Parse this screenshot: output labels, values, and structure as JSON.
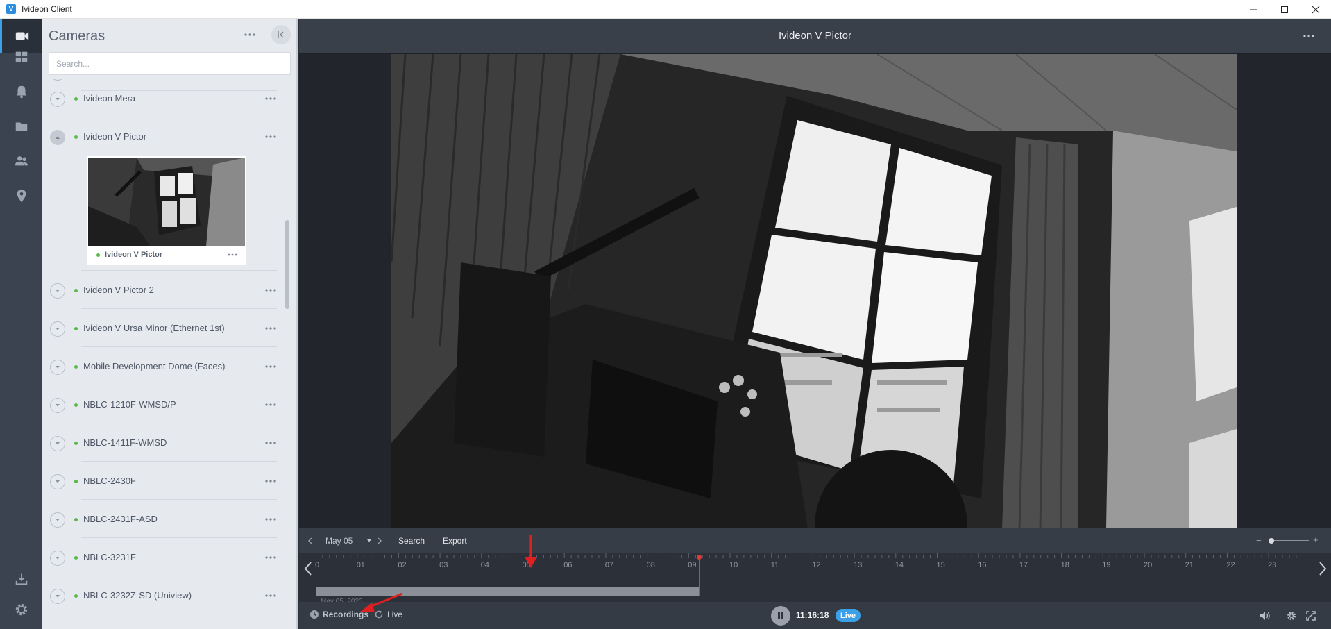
{
  "app": {
    "title": "Ivideon Client",
    "logo": "V"
  },
  "window_controls": [
    "minimize-icon",
    "maximize-icon",
    "close-icon"
  ],
  "rail": {
    "items": [
      "camera-icon",
      "grid-icon",
      "bell-icon",
      "folder-icon",
      "users-icon",
      "location-pin-icon"
    ],
    "bottom": [
      "download-icon",
      "gear-icon"
    ]
  },
  "panel": {
    "title": "Cameras",
    "search_placeholder": "Search...",
    "cameras": [
      {
        "name": "Ivideon Mera",
        "online": true,
        "expanded": false
      },
      {
        "name": "Ivideon V Pictor",
        "online": true,
        "expanded": true
      },
      {
        "name": "Ivideon V Pictor 2",
        "online": true,
        "expanded": false
      },
      {
        "name": "Ivideon V Ursa Minor (Ethernet 1st)",
        "online": true,
        "expanded": false
      },
      {
        "name": "Mobile Development Dome (Faces)",
        "online": true,
        "expanded": false
      },
      {
        "name": "NBLC-1210F-WMSD/P",
        "online": true,
        "expanded": false
      },
      {
        "name": "NBLC-1411F-WMSD",
        "online": true,
        "expanded": false
      },
      {
        "name": "NBLC-2430F",
        "online": true,
        "expanded": false
      },
      {
        "name": "NBLC-2431F-ASD",
        "online": true,
        "expanded": false
      },
      {
        "name": "NBLC-3231F",
        "online": true,
        "expanded": false
      },
      {
        "name": "NBLC-3232Z-SD (Uniview)",
        "online": true,
        "expanded": false
      }
    ],
    "preview_label": "Ivideon V Pictor"
  },
  "main": {
    "camera_title": "Ivideon V Pictor"
  },
  "timeline": {
    "date": "May 05",
    "search_label": "Search",
    "export_label": "Export",
    "hours": [
      "0",
      "01",
      "02",
      "03",
      "04",
      "05",
      "06",
      "07",
      "08",
      "09",
      "10",
      "11",
      "12",
      "13",
      "14",
      "15",
      "16",
      "17",
      "18",
      "19",
      "20",
      "21",
      "22",
      "23"
    ],
    "recording_date": "May 05, 2023",
    "recordings_label": "Recordings",
    "live_label": "Live",
    "current_time": "11:16:18",
    "live_badge": "Live"
  },
  "colors": {
    "accent": "#3aa0e8",
    "online": "#58b848",
    "playhead": "#e23a3a",
    "annotation": "#e02020"
  }
}
